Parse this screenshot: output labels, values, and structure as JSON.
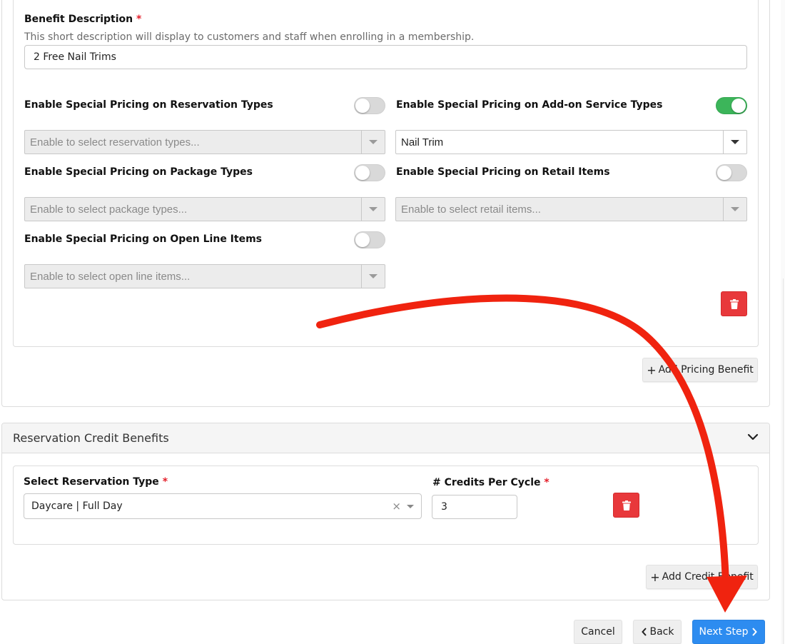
{
  "benefit": {
    "description_label": "Benefit Description",
    "required_mark": "*",
    "description_helper": "This short description will display to customers and staff when enrolling in a membership.",
    "description_value": "2 Free Nail Trims"
  },
  "pricing": {
    "reservation_types": {
      "label": "Enable Special Pricing on Reservation Types",
      "enabled": false,
      "placeholder": "Enable to select reservation types..."
    },
    "addon_service_types": {
      "label": "Enable Special Pricing on Add-on Service Types",
      "enabled": true,
      "value": "Nail Trim"
    },
    "package_types": {
      "label": "Enable Special Pricing on Package Types",
      "enabled": false,
      "placeholder": "Enable to select package types..."
    },
    "retail_items": {
      "label": "Enable Special Pricing on Retail Items",
      "enabled": false,
      "placeholder": "Enable to select retail items..."
    },
    "open_line_items": {
      "label": "Enable Special Pricing on Open Line Items",
      "enabled": false,
      "placeholder": "Enable to select open line items..."
    },
    "add_pricing_benefit": "Add Pricing Benefit"
  },
  "credits": {
    "section_title": "Reservation Credit Benefits",
    "select_type_label": "Select Reservation Type",
    "required_mark": "*",
    "select_type_value": "Daycare | Full Day",
    "credits_label": "# Credits Per Cycle",
    "credits_value": "3",
    "add_credit_benefit": "Add Credit Benefit"
  },
  "footer": {
    "cancel": "Cancel",
    "back": "Back",
    "next": "Next Step"
  },
  "colors": {
    "toggle_on": "#3cb55a",
    "danger": "#e8383b",
    "primary": "#2d8cf0",
    "annotation_arrow": "#f0230f"
  },
  "icons": {
    "trash": "trash-icon",
    "chevron_down": "chevron-down-icon",
    "clear": "clear-icon",
    "plus": "plus-icon",
    "chevron_left": "chevron-left-icon",
    "chevron_right": "chevron-right-icon"
  }
}
